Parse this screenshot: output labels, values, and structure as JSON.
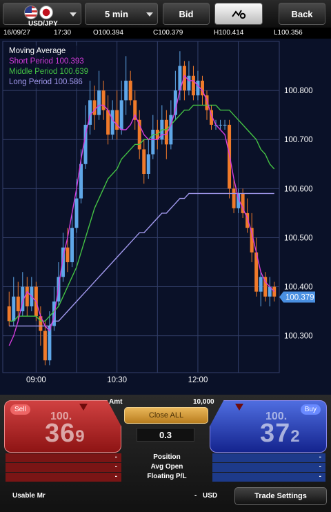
{
  "toolbar": {
    "pair": "USD/JPY",
    "timeframe": "5 min",
    "price_type": "Bid",
    "tool_icon": "chart-settings-icon",
    "back_label": "Back"
  },
  "info": {
    "date": "16/09/27",
    "time": "17:30",
    "open": "O100.394",
    "close": "C100.379",
    "high": "H100.414",
    "low": "L100.356"
  },
  "legend": {
    "title": "Moving Average",
    "short": "Short Period 100.393",
    "middle": "Middle Period 100.639",
    "long": "Long Period 100.586"
  },
  "colors": {
    "bg": "#0a1128",
    "grid": "#34406b",
    "up": "#5fa7e8",
    "down": "#f07a2a",
    "short_ma": "#d43cdc",
    "middle_ma": "#44c244",
    "long_ma": "#a39aef",
    "price_tag": "#4a90e2",
    "sell": "#c62b2b",
    "buy": "#2b46c6"
  },
  "chart_data": {
    "type": "candlestick",
    "x_ticks": [
      "09:00",
      "10:30",
      "12:00"
    ],
    "y_ticks": [
      "100.800",
      "100.700",
      "100.600",
      "100.500",
      "100.400",
      "100.300"
    ],
    "ylim": [
      100.225,
      100.9
    ],
    "current_price_label": "100.379",
    "candles": [
      [
        100.36,
        100.33,
        100.39,
        100.32
      ],
      [
        100.33,
        100.38,
        100.42,
        100.32
      ],
      [
        100.38,
        100.35,
        100.41,
        100.33
      ],
      [
        100.35,
        100.4,
        100.43,
        100.34
      ],
      [
        100.4,
        100.36,
        100.42,
        100.34
      ],
      [
        100.36,
        100.4,
        100.42,
        100.35
      ],
      [
        100.4,
        100.34,
        100.41,
        100.33
      ],
      [
        100.34,
        100.31,
        100.36,
        100.28
      ],
      [
        100.31,
        100.25,
        100.33,
        100.24
      ],
      [
        100.25,
        100.32,
        100.35,
        100.24
      ],
      [
        100.32,
        100.37,
        100.4,
        100.31
      ],
      [
        100.37,
        100.42,
        100.45,
        100.36
      ],
      [
        100.42,
        100.48,
        100.51,
        100.41
      ],
      [
        100.48,
        100.45,
        100.52,
        100.43
      ],
      [
        100.45,
        100.52,
        100.55,
        100.44
      ],
      [
        100.52,
        100.58,
        100.62,
        100.51
      ],
      [
        100.58,
        100.65,
        100.68,
        100.57
      ],
      [
        100.65,
        100.73,
        100.77,
        100.64
      ],
      [
        100.73,
        100.78,
        100.82,
        100.71
      ],
      [
        100.78,
        100.75,
        100.81,
        100.72
      ],
      [
        100.75,
        100.8,
        100.84,
        100.74
      ],
      [
        100.8,
        100.76,
        100.82,
        100.74
      ],
      [
        100.76,
        100.71,
        100.79,
        100.69
      ],
      [
        100.71,
        100.76,
        100.78,
        100.7
      ],
      [
        100.76,
        100.72,
        100.8,
        100.7
      ],
      [
        100.72,
        100.78,
        100.82,
        100.71
      ],
      [
        100.78,
        100.82,
        100.87,
        100.75
      ],
      [
        100.82,
        100.78,
        100.84,
        100.77
      ],
      [
        100.78,
        100.74,
        100.8,
        100.72
      ],
      [
        100.74,
        100.68,
        100.76,
        100.66
      ],
      [
        100.68,
        100.63,
        100.7,
        100.61
      ],
      [
        100.63,
        100.67,
        100.7,
        100.62
      ],
      [
        100.67,
        100.72,
        100.75,
        100.66
      ],
      [
        100.72,
        100.7,
        100.74,
        100.68
      ],
      [
        100.7,
        100.74,
        100.77,
        100.69
      ],
      [
        100.74,
        100.69,
        100.76,
        100.66
      ],
      [
        100.69,
        100.75,
        100.78,
        100.68
      ],
      [
        100.75,
        100.8,
        100.84,
        100.74
      ],
      [
        100.8,
        100.85,
        100.88,
        100.78
      ],
      [
        100.85,
        100.8,
        100.86,
        100.78
      ],
      [
        100.8,
        100.83,
        100.86,
        100.79
      ],
      [
        100.83,
        100.79,
        100.85,
        100.78
      ],
      [
        100.79,
        100.82,
        100.84,
        100.78
      ],
      [
        100.82,
        100.79,
        100.83,
        100.77
      ],
      [
        100.79,
        100.76,
        100.8,
        100.74
      ],
      [
        100.76,
        100.73,
        100.77,
        100.72
      ],
      [
        100.73,
        100.73,
        100.74,
        100.72
      ],
      [
        100.73,
        100.73,
        100.74,
        100.72
      ],
      [
        100.73,
        100.73,
        100.74,
        100.72
      ],
      [
        100.73,
        100.6,
        100.74,
        100.58
      ],
      [
        100.6,
        100.56,
        100.62,
        100.55
      ],
      [
        100.56,
        100.59,
        100.6,
        100.55
      ],
      [
        100.59,
        100.55,
        100.6,
        100.54
      ],
      [
        100.55,
        100.52,
        100.58,
        100.51
      ],
      [
        100.52,
        100.47,
        100.55,
        100.45
      ],
      [
        100.47,
        100.39,
        100.5,
        100.38
      ],
      [
        100.39,
        100.42,
        100.43,
        100.36
      ],
      [
        100.42,
        100.38,
        100.43,
        100.37
      ],
      [
        100.38,
        100.4,
        100.42,
        100.36
      ],
      [
        100.4,
        100.38,
        100.41,
        100.37
      ]
    ],
    "ma_short": [
      100.28,
      100.3,
      100.33,
      100.37,
      100.39,
      100.38,
      100.37,
      100.34,
      100.32,
      100.31,
      100.34,
      100.4,
      100.46,
      100.5,
      100.55,
      100.6,
      100.66,
      100.71,
      100.75,
      100.76,
      100.77,
      100.77,
      100.76,
      100.74,
      100.73,
      100.72,
      100.72,
      100.73,
      100.75,
      100.73,
      100.71,
      100.7,
      100.7,
      100.7,
      100.71,
      100.71,
      100.73,
      100.76,
      100.8,
      100.83,
      100.82,
      100.82,
      100.81,
      100.8,
      100.78,
      100.75,
      100.73,
      100.72,
      100.71,
      100.67,
      100.62,
      100.58,
      100.56,
      100.54,
      100.51,
      100.47,
      100.43,
      100.41,
      100.4,
      100.39
    ],
    "ma_middle": [
      100.33,
      100.33,
      100.34,
      100.34,
      100.34,
      100.34,
      100.34,
      100.33,
      100.33,
      100.34,
      100.35,
      100.36,
      100.38,
      100.4,
      100.42,
      100.44,
      100.47,
      100.5,
      100.53,
      100.56,
      100.58,
      100.6,
      100.62,
      100.63,
      100.64,
      100.66,
      100.67,
      100.68,
      100.69,
      100.69,
      100.7,
      100.7,
      100.71,
      100.71,
      100.72,
      100.72,
      100.73,
      100.74,
      100.75,
      100.76,
      100.76,
      100.77,
      100.77,
      100.77,
      100.77,
      100.77,
      100.77,
      100.76,
      100.76,
      100.76,
      100.75,
      100.74,
      100.73,
      100.72,
      100.71,
      100.7,
      100.68,
      100.67,
      100.65,
      100.64
    ],
    "ma_long": [
      100.32,
      100.32,
      100.32,
      100.32,
      100.32,
      100.32,
      100.32,
      100.32,
      100.32,
      100.32,
      100.33,
      100.33,
      100.34,
      100.35,
      100.36,
      100.37,
      100.38,
      100.39,
      100.4,
      100.41,
      100.42,
      100.43,
      100.44,
      100.45,
      100.46,
      100.47,
      100.48,
      100.49,
      100.5,
      100.51,
      100.51,
      100.52,
      100.53,
      100.54,
      100.55,
      100.55,
      100.56,
      100.57,
      100.58,
      100.58,
      100.59,
      100.59,
      100.59,
      100.59,
      100.59,
      100.59,
      100.59,
      100.59,
      100.59,
      100.59,
      100.59,
      100.59,
      100.59,
      100.59,
      100.59,
      100.59,
      100.59,
      100.59,
      100.59,
      100.59
    ]
  },
  "trade": {
    "sell_label": "Sell",
    "buy_label": "Buy",
    "sell_price_prefix": "100.",
    "sell_price_big": "36",
    "sell_price_small": "9",
    "buy_price_prefix": "100.",
    "buy_price_big": "37",
    "buy_price_small": "2",
    "amt_label": "Amt",
    "amt_value": "10,000",
    "close_all_label": "Close ALL",
    "lot": "0.3",
    "stats": [
      {
        "label": "Position",
        "sell": "-",
        "buy": "-"
      },
      {
        "label": "Avg Open",
        "sell": "-",
        "buy": "-"
      },
      {
        "label": "Floating P/L",
        "sell": "-",
        "buy": "-"
      }
    ],
    "usable_label": "Usable Mr",
    "usable_value": "-",
    "currency": "USD",
    "settings_label": "Trade Settings"
  }
}
